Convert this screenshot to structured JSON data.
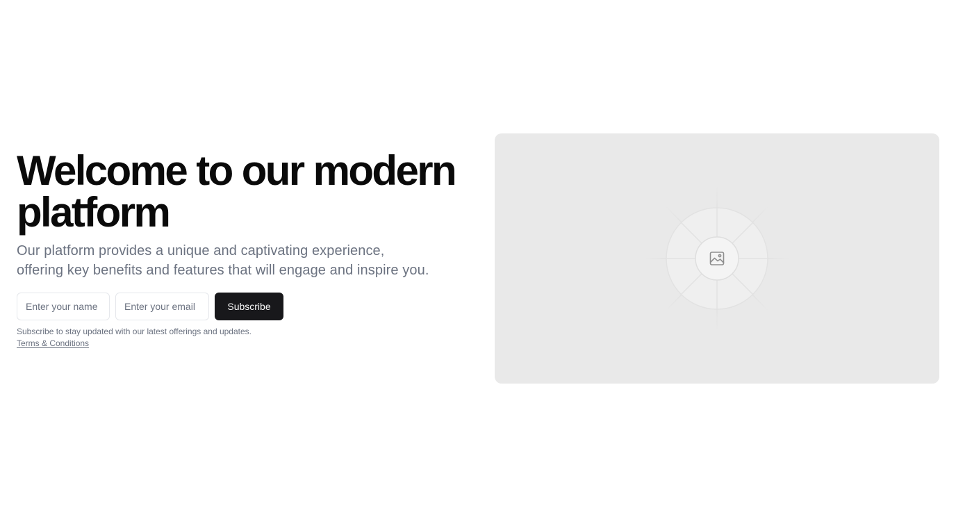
{
  "hero": {
    "title_line1": "Welcome to our modern",
    "title_line2": "platform",
    "subtitle": "Our platform provides a unique and captivating experience, offering key benefits and features that will engage and inspire you."
  },
  "form": {
    "name_placeholder": "Enter your name",
    "email_placeholder": "Enter your email",
    "subscribe_label": "Subscribe",
    "note": "Subscribe to stay updated with our latest offerings and updates.",
    "terms_label": "Terms & Conditions"
  },
  "media": {
    "icon": "image-icon"
  },
  "colors": {
    "button_bg": "#18181b",
    "placeholder_bg": "#e9e9e9",
    "muted_text": "#6b7280"
  }
}
